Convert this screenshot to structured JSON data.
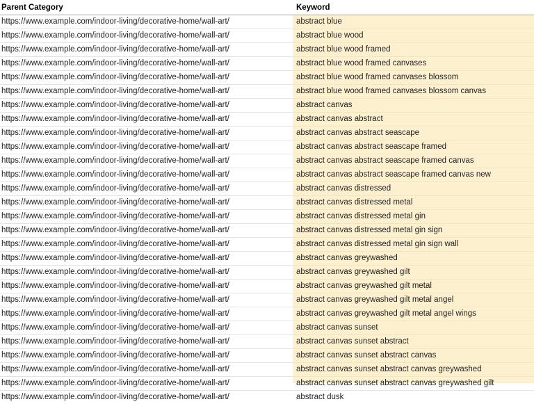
{
  "spreadsheet": {
    "columns": [
      {
        "key": "parent_category",
        "header": "Parent Category"
      },
      {
        "key": "keyword",
        "header": "Keyword"
      }
    ],
    "highlight_color": "#fdf0ce",
    "gridline_color": "#e3e3e3",
    "header_rule_color": "#a6a6a6",
    "text_color": "#1f1f1f",
    "rows": [
      {
        "parent_category": "https://www.example.com/indoor-living/decorative-home/wall-art/",
        "keyword": "abstract blue"
      },
      {
        "parent_category": "https://www.example.com/indoor-living/decorative-home/wall-art/",
        "keyword": "abstract blue wood"
      },
      {
        "parent_category": "https://www.example.com/indoor-living/decorative-home/wall-art/",
        "keyword": "abstract blue wood framed"
      },
      {
        "parent_category": "https://www.example.com/indoor-living/decorative-home/wall-art/",
        "keyword": "abstract blue wood framed canvases"
      },
      {
        "parent_category": "https://www.example.com/indoor-living/decorative-home/wall-art/",
        "keyword": "abstract blue wood framed canvases blossom"
      },
      {
        "parent_category": "https://www.example.com/indoor-living/decorative-home/wall-art/",
        "keyword": "abstract blue wood framed canvases blossom canvas"
      },
      {
        "parent_category": "https://www.example.com/indoor-living/decorative-home/wall-art/",
        "keyword": "abstract canvas"
      },
      {
        "parent_category": "https://www.example.com/indoor-living/decorative-home/wall-art/",
        "keyword": "abstract canvas abstract"
      },
      {
        "parent_category": "https://www.example.com/indoor-living/decorative-home/wall-art/",
        "keyword": "abstract canvas abstract seascape"
      },
      {
        "parent_category": "https://www.example.com/indoor-living/decorative-home/wall-art/",
        "keyword": "abstract canvas abstract seascape framed"
      },
      {
        "parent_category": "https://www.example.com/indoor-living/decorative-home/wall-art/",
        "keyword": "abstract canvas abstract seascape framed canvas"
      },
      {
        "parent_category": "https://www.example.com/indoor-living/decorative-home/wall-art/",
        "keyword": "abstract canvas abstract seascape framed canvas new"
      },
      {
        "parent_category": "https://www.example.com/indoor-living/decorative-home/wall-art/",
        "keyword": "abstract canvas distressed"
      },
      {
        "parent_category": "https://www.example.com/indoor-living/decorative-home/wall-art/",
        "keyword": "abstract canvas distressed metal"
      },
      {
        "parent_category": "https://www.example.com/indoor-living/decorative-home/wall-art/",
        "keyword": "abstract canvas distressed metal gin"
      },
      {
        "parent_category": "https://www.example.com/indoor-living/decorative-home/wall-art/",
        "keyword": "abstract canvas distressed metal gin sign"
      },
      {
        "parent_category": "https://www.example.com/indoor-living/decorative-home/wall-art/",
        "keyword": "abstract canvas distressed metal gin sign wall"
      },
      {
        "parent_category": "https://www.example.com/indoor-living/decorative-home/wall-art/",
        "keyword": "abstract canvas greywashed"
      },
      {
        "parent_category": "https://www.example.com/indoor-living/decorative-home/wall-art/",
        "keyword": "abstract canvas greywashed gilt"
      },
      {
        "parent_category": "https://www.example.com/indoor-living/decorative-home/wall-art/",
        "keyword": "abstract canvas greywashed gilt metal"
      },
      {
        "parent_category": "https://www.example.com/indoor-living/decorative-home/wall-art/",
        "keyword": "abstract canvas greywashed gilt metal angel"
      },
      {
        "parent_category": "https://www.example.com/indoor-living/decorative-home/wall-art/",
        "keyword": "abstract canvas greywashed gilt metal angel wings"
      },
      {
        "parent_category": "https://www.example.com/indoor-living/decorative-home/wall-art/",
        "keyword": "abstract canvas sunset"
      },
      {
        "parent_category": "https://www.example.com/indoor-living/decorative-home/wall-art/",
        "keyword": "abstract canvas sunset abstract"
      },
      {
        "parent_category": "https://www.example.com/indoor-living/decorative-home/wall-art/",
        "keyword": "abstract canvas sunset abstract canvas"
      },
      {
        "parent_category": "https://www.example.com/indoor-living/decorative-home/wall-art/",
        "keyword": "abstract canvas sunset abstract canvas greywashed"
      },
      {
        "parent_category": "https://www.example.com/indoor-living/decorative-home/wall-art/",
        "keyword": "abstract canvas sunset abstract canvas greywashed gilt"
      },
      {
        "parent_category": "https://www.example.com/indoor-living/decorative-home/wall-art/",
        "keyword": "abstract dusk"
      }
    ]
  }
}
